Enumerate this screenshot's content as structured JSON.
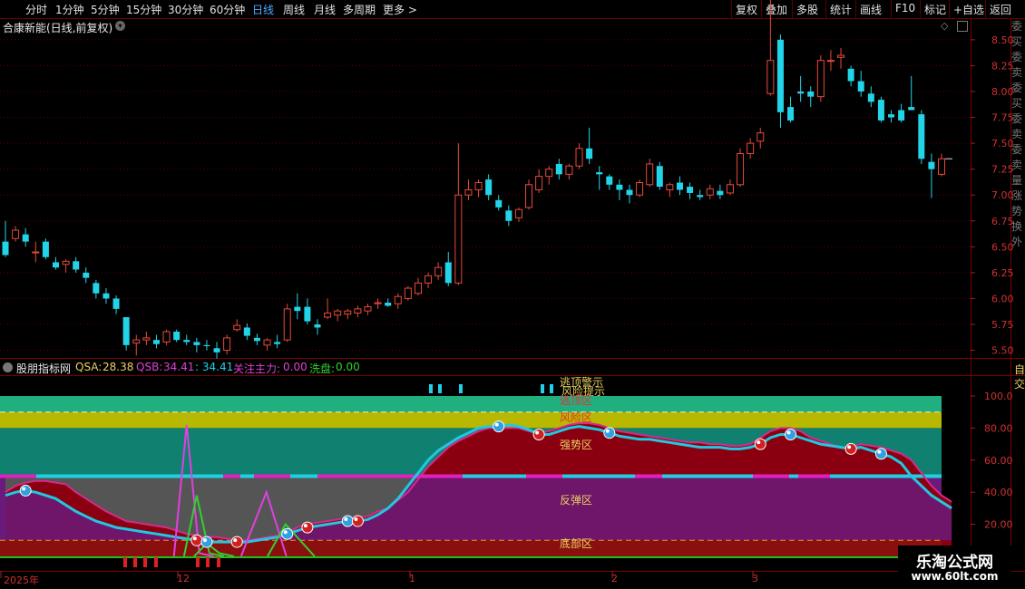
{
  "toolbar": {
    "periods": [
      "分时",
      "1分钟",
      "5分钟",
      "15分钟",
      "30分钟",
      "60分钟",
      "日线",
      "周线",
      "月线",
      "多周期",
      "更多 >"
    ],
    "active_period": "日线",
    "actions": [
      "复权",
      "叠加",
      "多股",
      "统计",
      "画线",
      "F10",
      "标记",
      "+自选",
      "返回"
    ]
  },
  "main_chart": {
    "title": "合康新能(日线,前复权)",
    "price_ticks": [
      "8.50",
      "8.25",
      "8.00",
      "7.75",
      "7.50",
      "7.25",
      "7.00",
      "6.75",
      "6.50",
      "6.25",
      "6.00",
      "5.75",
      "5.50"
    ],
    "side_text": "委买委卖委买委卖委卖量涨势换外",
    "colors": {
      "up": "#e84a3a",
      "down": "#22d4e8",
      "grid": "#5a0000"
    }
  },
  "indicator": {
    "name": "股朋指标网",
    "qsa_label": "QSA:",
    "qsa_value": "28.38",
    "qsb_label": "QSB:",
    "qsb_value": "34.41",
    "extra_value": ": 34.41",
    "zhuli_label": "关注主力:",
    "zhuli_value": "0.00",
    "xipan_label": "洗盘:",
    "xipan_value": "0.00",
    "side_label": "自交",
    "ticks": [
      "100.0",
      "80.00",
      "60.00",
      "40.00",
      "20.00"
    ],
    "zone_labels": [
      "逃顶警示",
      "风险提示",
      "逃顶区",
      "风险区",
      "强势区",
      "反弹区",
      "底部区"
    ]
  },
  "x_axis": {
    "labels": [
      "2025年",
      "12",
      "1",
      "2",
      "3"
    ]
  },
  "watermark": {
    "title": "乐淘公式网",
    "url": "www.60lt.com"
  },
  "chart_data": [
    {
      "type": "candlestick",
      "title": "合康新能(日线,前复权)",
      "y_range": [
        5.4,
        8.7
      ],
      "ohlc": [
        [
          6.55,
          6.75,
          6.4,
          6.42
        ],
        [
          6.58,
          6.7,
          6.55,
          6.66
        ],
        [
          6.62,
          6.68,
          6.5,
          6.55
        ],
        [
          6.45,
          6.55,
          6.35,
          6.45
        ],
        [
          6.55,
          6.58,
          6.38,
          6.4
        ],
        [
          6.35,
          6.4,
          6.28,
          6.3
        ],
        [
          6.33,
          6.38,
          6.25,
          6.36
        ],
        [
          6.36,
          6.4,
          6.25,
          6.28
        ],
        [
          6.25,
          6.3,
          6.15,
          6.2
        ],
        [
          6.15,
          6.18,
          6.0,
          6.05
        ],
        [
          6.05,
          6.1,
          5.95,
          6.0
        ],
        [
          6.0,
          6.03,
          5.85,
          5.9
        ],
        [
          5.82,
          5.82,
          5.5,
          5.55
        ],
        [
          5.57,
          5.65,
          5.45,
          5.6
        ],
        [
          5.6,
          5.68,
          5.55,
          5.62
        ],
        [
          5.6,
          5.65,
          5.52,
          5.56
        ],
        [
          5.58,
          5.7,
          5.55,
          5.68
        ],
        [
          5.68,
          5.7,
          5.58,
          5.6
        ],
        [
          5.6,
          5.65,
          5.55,
          5.58
        ],
        [
          5.58,
          5.62,
          5.48,
          5.55
        ],
        [
          5.55,
          5.6,
          5.5,
          5.54
        ],
        [
          5.52,
          5.58,
          5.42,
          5.48
        ],
        [
          5.5,
          5.65,
          5.46,
          5.62
        ],
        [
          5.7,
          5.8,
          5.68,
          5.74
        ],
        [
          5.72,
          5.76,
          5.6,
          5.64
        ],
        [
          5.62,
          5.66,
          5.55,
          5.59
        ],
        [
          5.55,
          5.62,
          5.5,
          5.6
        ],
        [
          5.58,
          5.65,
          5.52,
          5.56
        ],
        [
          5.6,
          5.95,
          5.58,
          5.9
        ],
        [
          5.92,
          6.05,
          5.8,
          5.88
        ],
        [
          5.92,
          6.0,
          5.75,
          5.78
        ],
        [
          5.75,
          5.8,
          5.65,
          5.72
        ],
        [
          5.82,
          6.0,
          5.8,
          5.86
        ],
        [
          5.84,
          5.9,
          5.78,
          5.88
        ],
        [
          5.85,
          5.9,
          5.8,
          5.88
        ],
        [
          5.86,
          5.93,
          5.82,
          5.9
        ],
        [
          5.88,
          5.95,
          5.84,
          5.92
        ],
        [
          5.95,
          6.0,
          5.9,
          5.96
        ],
        [
          5.96,
          6.0,
          5.92,
          5.93
        ],
        [
          5.95,
          6.05,
          5.9,
          6.02
        ],
        [
          6.0,
          6.12,
          5.98,
          6.1
        ],
        [
          6.05,
          6.2,
          6.03,
          6.15
        ],
        [
          6.15,
          6.25,
          6.1,
          6.22
        ],
        [
          6.22,
          6.35,
          6.18,
          6.3
        ],
        [
          6.35,
          6.45,
          6.12,
          6.15
        ],
        [
          6.15,
          7.5,
          6.13,
          7.0
        ],
        [
          7.0,
          7.15,
          6.95,
          7.05
        ],
        [
          7.05,
          7.15,
          6.98,
          7.12
        ],
        [
          7.15,
          7.2,
          6.95,
          7.0
        ],
        [
          6.95,
          7.0,
          6.85,
          6.88
        ],
        [
          6.85,
          6.9,
          6.7,
          6.75
        ],
        [
          6.78,
          6.88,
          6.74,
          6.86
        ],
        [
          6.88,
          7.15,
          6.86,
          7.1
        ],
        [
          7.05,
          7.25,
          7.02,
          7.18
        ],
        [
          7.18,
          7.28,
          7.1,
          7.25
        ],
        [
          7.3,
          7.35,
          7.15,
          7.2
        ],
        [
          7.2,
          7.3,
          7.15,
          7.28
        ],
        [
          7.28,
          7.5,
          7.25,
          7.45
        ],
        [
          7.45,
          7.65,
          7.3,
          7.35
        ],
        [
          7.22,
          7.28,
          7.05,
          7.2
        ],
        [
          7.18,
          7.2,
          7.05,
          7.1
        ],
        [
          7.1,
          7.15,
          6.95,
          7.05
        ],
        [
          7.05,
          7.1,
          6.92,
          7.0
        ],
        [
          7.0,
          7.15,
          6.98,
          7.12
        ],
        [
          7.1,
          7.35,
          7.08,
          7.3
        ],
        [
          7.28,
          7.32,
          7.05,
          7.08
        ],
        [
          7.05,
          7.12,
          6.98,
          7.1
        ],
        [
          7.12,
          7.18,
          7.0,
          7.05
        ],
        [
          7.08,
          7.12,
          6.96,
          7.02
        ],
        [
          7.0,
          7.05,
          6.95,
          6.98
        ],
        [
          7.0,
          7.1,
          6.96,
          7.06
        ],
        [
          7.04,
          7.1,
          6.96,
          7.0
        ],
        [
          7.02,
          7.15,
          7.0,
          7.1
        ],
        [
          7.1,
          7.45,
          7.08,
          7.4
        ],
        [
          7.4,
          7.55,
          7.35,
          7.5
        ],
        [
          7.52,
          7.65,
          7.45,
          7.6
        ],
        [
          7.98,
          8.9,
          7.96,
          8.3
        ],
        [
          8.5,
          8.55,
          7.65,
          7.8
        ],
        [
          7.85,
          7.95,
          7.7,
          7.72
        ],
        [
          8.0,
          8.15,
          7.9,
          7.98
        ],
        [
          8.0,
          8.05,
          7.85,
          7.95
        ],
        [
          7.95,
          8.35,
          7.9,
          8.3
        ],
        [
          8.3,
          8.4,
          8.2,
          8.3
        ],
        [
          8.33,
          8.42,
          8.22,
          8.35
        ],
        [
          8.22,
          8.25,
          8.05,
          8.1
        ],
        [
          8.1,
          8.2,
          7.95,
          8.0
        ],
        [
          7.98,
          8.05,
          7.85,
          7.9
        ],
        [
          7.92,
          7.95,
          7.7,
          7.72
        ],
        [
          7.78,
          7.82,
          7.7,
          7.75
        ],
        [
          7.82,
          7.88,
          7.7,
          7.72
        ],
        [
          7.85,
          8.15,
          7.82,
          7.82
        ],
        [
          7.78,
          7.82,
          7.3,
          7.35
        ],
        [
          7.32,
          7.4,
          6.97,
          7.25
        ],
        [
          7.2,
          7.4,
          7.18,
          7.35
        ]
      ]
    },
    {
      "type": "line",
      "title": "股朋指标网",
      "y_range": [
        0,
        100
      ],
      "zones": [
        {
          "name": "逃顶区",
          "from": 90,
          "to": 100,
          "color": "#20b080"
        },
        {
          "name": "风险区",
          "from": 80,
          "to": 90,
          "color": "#b8b800"
        },
        {
          "name": "强势区",
          "from": 50,
          "to": 80,
          "color": "#108070"
        },
        {
          "name": "反弹区",
          "from": 10,
          "to": 50,
          "color": "#6a1a7a"
        },
        {
          "name": "底部区",
          "from": 0,
          "to": 10,
          "color": "#8a1010"
        }
      ],
      "series": [
        {
          "name": "QSA",
          "color": "#d42a8a",
          "values": [
            40,
            44,
            46,
            47,
            47,
            46,
            45,
            40,
            36,
            32,
            28,
            25,
            22,
            21,
            20,
            19,
            18,
            16,
            14,
            13,
            12,
            12,
            11,
            10,
            10,
            11,
            12,
            13,
            15,
            18,
            20,
            21,
            22,
            23,
            24,
            24,
            25,
            28,
            30,
            35,
            40,
            48,
            56,
            62,
            68,
            72,
            75,
            78,
            80,
            80,
            80,
            80,
            78,
            77,
            78,
            80,
            82,
            83,
            83,
            82,
            80,
            78,
            77,
            76,
            75,
            74,
            73,
            72,
            71,
            71,
            70,
            70,
            69,
            69,
            70,
            74,
            78,
            80,
            80,
            78,
            74,
            72,
            70,
            68,
            68,
            70,
            69,
            68,
            66,
            64,
            60,
            52,
            44,
            38,
            34
          ]
        },
        {
          "name": "QSB",
          "color": "#20c8e0",
          "values": [
            38,
            40,
            41,
            40,
            38,
            36,
            32,
            28,
            25,
            22,
            20,
            18,
            17,
            16,
            15,
            14,
            13,
            12,
            11,
            10,
            9,
            9,
            9,
            9,
            9,
            10,
            11,
            12,
            14,
            16,
            18,
            19,
            20,
            21,
            22,
            22,
            23,
            26,
            30,
            36,
            44,
            52,
            60,
            66,
            70,
            74,
            77,
            80,
            81,
            81,
            82,
            81,
            79,
            76,
            76,
            78,
            80,
            81,
            80,
            79,
            77,
            75,
            74,
            73,
            73,
            72,
            71,
            70,
            69,
            68,
            68,
            68,
            67,
            67,
            68,
            70,
            74,
            76,
            76,
            74,
            72,
            70,
            69,
            68,
            67,
            68,
            66,
            64,
            62,
            58,
            50,
            44,
            38,
            34,
            30
          ]
        },
        {
          "name": "关注主力",
          "color": "#e040e0",
          "values": [
            0,
            0,
            0,
            0,
            0,
            0,
            0,
            0,
            0,
            0,
            0,
            0,
            0,
            0,
            0,
            0,
            0,
            0,
            82,
            0,
            0,
            0,
            0,
            0,
            0,
            0,
            0,
            0,
            0,
            0,
            0,
            0,
            0,
            0,
            0,
            0,
            0,
            0,
            0,
            0,
            0,
            0,
            0,
            0,
            0,
            0,
            0,
            0,
            0,
            0,
            0,
            0,
            0,
            0,
            0,
            0,
            0,
            0,
            0,
            0,
            0,
            0,
            0,
            0,
            0,
            0,
            0,
            0,
            0,
            0,
            0,
            0,
            0,
            0,
            0,
            0,
            0,
            0,
            0,
            0,
            0,
            0,
            0,
            0,
            0,
            0,
            0,
            0,
            0,
            0,
            0,
            0,
            0,
            0,
            0
          ]
        },
        {
          "name": "洗盘",
          "color": "#30d030",
          "values": [
            0,
            0,
            0,
            0,
            0,
            0,
            0,
            0,
            0,
            0,
            0,
            0,
            0,
            0,
            0,
            0,
            0,
            0,
            0,
            38,
            8,
            0,
            0,
            0,
            0,
            0,
            0,
            0,
            0,
            0,
            0,
            0,
            0,
            0,
            0,
            0,
            0,
            0,
            0,
            0,
            0,
            0,
            0,
            0,
            0,
            0,
            0,
            0,
            0,
            0,
            0,
            0,
            0,
            0,
            0,
            0,
            0,
            0,
            0,
            0,
            0,
            0,
            0,
            0,
            0,
            0,
            0,
            0,
            0,
            0,
            0,
            0,
            0,
            0,
            0,
            0,
            0,
            0,
            0,
            0,
            0,
            0,
            0,
            0,
            0,
            0,
            0,
            0,
            0,
            0,
            0,
            0,
            0,
            0,
            0
          ]
        }
      ]
    }
  ]
}
